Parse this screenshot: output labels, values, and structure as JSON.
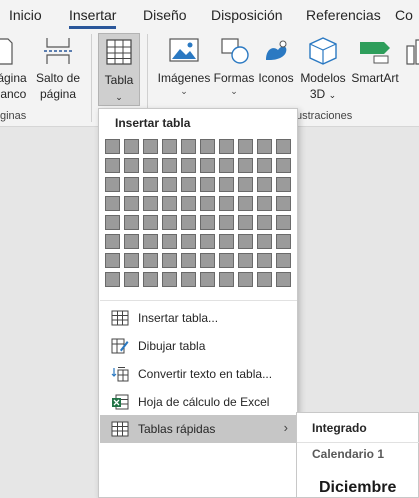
{
  "tabs": [
    {
      "label": "Inicio",
      "active": false
    },
    {
      "label": "Insertar",
      "active": true
    },
    {
      "label": "Diseño",
      "active": false
    },
    {
      "label": "Disposición",
      "active": false
    },
    {
      "label": "Referencias",
      "active": false
    },
    {
      "label": "Co",
      "active": false
    }
  ],
  "ribbon": {
    "pagina_line1": "ágina",
    "pagina_line2": "lanco",
    "salto_line1": "Salto de",
    "salto_line2": "página",
    "tabla": "Tabla",
    "imagenes": "Imágenes",
    "formas": "Formas",
    "iconos": "Iconos",
    "modelos_line1": "Modelos",
    "modelos_line2": "3D",
    "smartart": "SmartArt",
    "group_paginas": "ginas",
    "group_ilustraciones": "ustraciones"
  },
  "dropdown": {
    "title": "Insertar tabla",
    "grid_cols": 10,
    "grid_rows": 8,
    "items": [
      {
        "label": "Insertar tabla...",
        "icon": "insert-table-icon"
      },
      {
        "label": "Dibujar tabla",
        "icon": "draw-table-icon"
      },
      {
        "label": "Convertir texto en tabla...",
        "icon": "convert-text-icon"
      },
      {
        "label": "Hoja de cálculo de Excel",
        "icon": "excel-icon"
      },
      {
        "label": "Tablas rápidas",
        "icon": "quick-tables-icon",
        "submenu": true
      }
    ]
  },
  "submenu": {
    "section": "Integrado",
    "item1": "Calendario 1",
    "preview": "Diciembre"
  },
  "colors": {
    "accent": "#2b579a",
    "excel_green": "#217346"
  }
}
